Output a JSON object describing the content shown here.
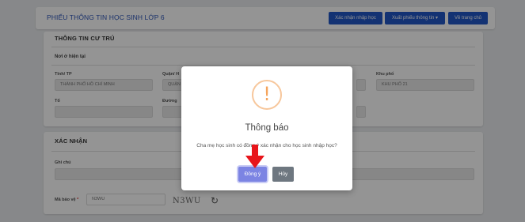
{
  "header": {
    "title": "PHIẾU THÔNG TIN HỌC SINH LỚP 6",
    "buttons": {
      "confirm_admission": "Xác nhận nhập học",
      "export_form": "Xuất phiếu thông tin ▾",
      "home": "Về trang chủ"
    }
  },
  "residence": {
    "title": "THÔNG TIN CƯ TRÚ",
    "subtitle": "Nơi ở hiện tại",
    "fields": {
      "province_label": "Tỉnh/ TP",
      "province_value": "THÀNH PHỐ HỒ CHÍ MINH",
      "district_label": "Quận/ H",
      "district_value": "QUẬN",
      "ward_label": "Khu phố",
      "ward_value": "KHU PHỐ 21",
      "group_label": "Tổ",
      "street_label": "Đường"
    }
  },
  "confirmation": {
    "title": "XÁC NHẬN",
    "note_label": "Ghi chú",
    "captcha_label": "Mã bảo vệ",
    "captcha_required": "*",
    "captcha_value": "N3WU",
    "captcha_image_text": "N3WU"
  },
  "dialog": {
    "title": "Thông báo",
    "message": "Cha mẹ học sinh có đồng ý xác nhận cho học sinh nhập học?",
    "icon_glyph": "!",
    "ok_label": "Đồng ý",
    "cancel_label": "Hủy"
  },
  "colors": {
    "primary": "#2157c6",
    "title_blue": "#2f56b8",
    "warning": "#f5a45b",
    "ok_button": "#7c84e3",
    "cancel_button": "#6e7780",
    "arrow": "#e8151b"
  }
}
